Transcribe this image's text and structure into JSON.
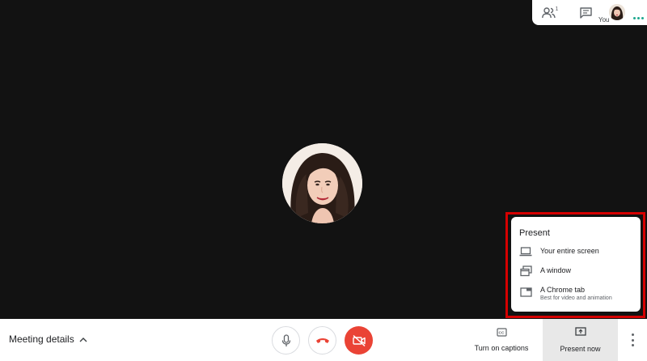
{
  "top_panel": {
    "people_count": "1",
    "self_label": "You"
  },
  "present_menu": {
    "title": "Present",
    "items": [
      {
        "label": "Your entire screen",
        "icon": "laptop-icon"
      },
      {
        "label": "A window",
        "icon": "window-icon"
      },
      {
        "label": "A Chrome tab",
        "sublabel": "Best for video and animation",
        "icon": "tab-icon"
      }
    ]
  },
  "bottom_bar": {
    "meeting_details": "Meeting details",
    "captions_label": "Turn on captions",
    "present_label": "Present now"
  },
  "colors": {
    "background": "#121212",
    "end_call": "#ea4335",
    "camera_off": "#ea4335",
    "highlight": "#d50000",
    "accent_dots": "#1ea88f"
  }
}
